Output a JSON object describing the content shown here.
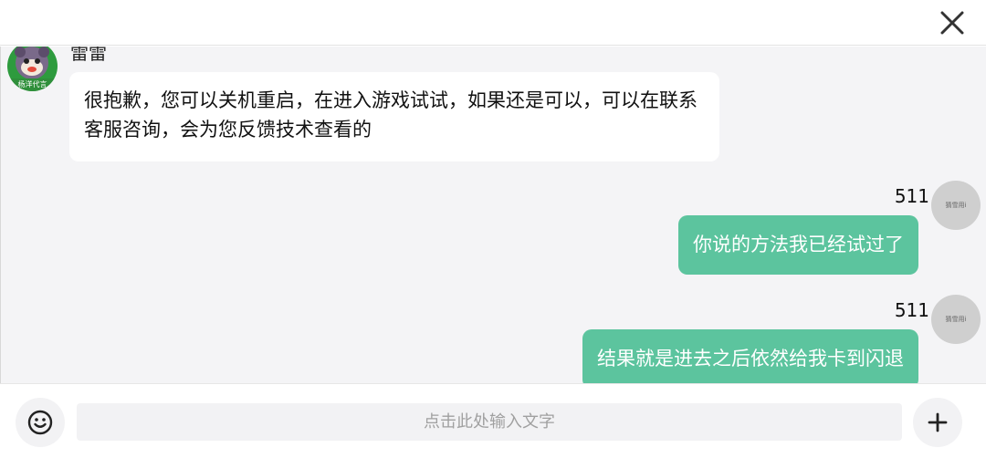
{
  "header": {
    "close_icon": "close-icon"
  },
  "messages": [
    {
      "side": "left",
      "sender": "雷雷",
      "avatar_label": "杨洋代言",
      "text": "很抱歉，您可以关机重启，在进入游戏试试，如果还是可以，可以在联系客服咨询，会为您反馈技术查看的"
    },
    {
      "side": "right",
      "sender": "511",
      "avatar_label": "猜雪用i",
      "text": "你说的方法我已经试过了"
    },
    {
      "side": "right",
      "sender": "511",
      "avatar_label": "猜雪用i",
      "text": "结果就是进去之后依然给我卡到闪退"
    }
  ],
  "composer": {
    "placeholder": "点击此处输入文字",
    "emoji_icon": "emoji-icon",
    "plus_icon": "plus-icon"
  },
  "colors": {
    "bubble_right": "#5cc49e",
    "bubble_left": "#ffffff",
    "chat_background": "#f4f4f6"
  }
}
